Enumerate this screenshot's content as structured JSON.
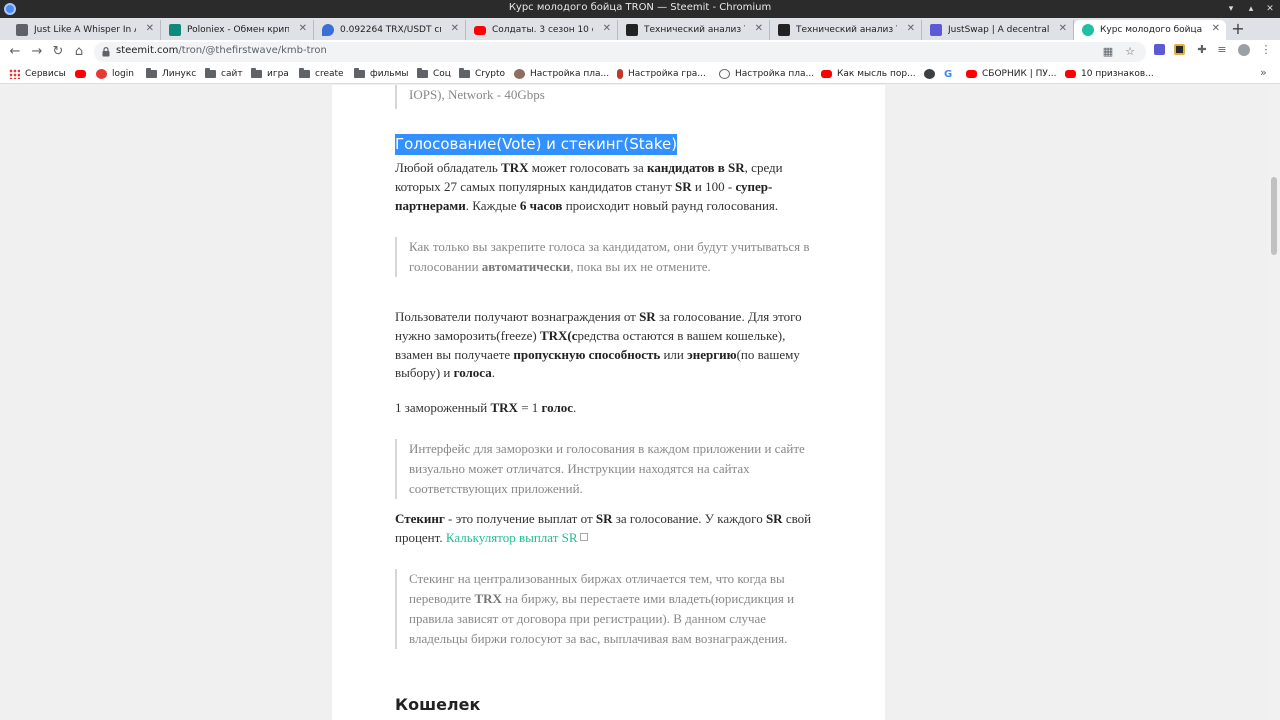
{
  "window": {
    "title": "Курс молодого бойца TRON — Steemit - Chromium"
  },
  "tabs": [
    {
      "label": "Just Like A Whisper In A N",
      "color": "#5f6368"
    },
    {
      "label": "Poloniex - Обмен крипто",
      "color": "#0e8a7a"
    },
    {
      "label": "0.092264 TRX/USDT спот",
      "color": "#3a6fd8"
    },
    {
      "label": "Солдаты. 3 сезон 10 сер",
      "color": "#ff0000"
    },
    {
      "label": "Технический анализ TRO",
      "color": "#222222"
    },
    {
      "label": "Технический анализ TRO",
      "color": "#222222"
    },
    {
      "label": "JustSwap | A decentralize",
      "color": "#5b5bd6"
    },
    {
      "label": "Курс молодого бойца TR",
      "color": "#1fbfa0"
    }
  ],
  "address": {
    "domain": "steemit.com",
    "path": "/tron/@thefirstwave/kmb-tron"
  },
  "bookmarks": [
    {
      "label": "Сервисы",
      "icon": "apps-icon"
    },
    {
      "label": "",
      "icon": "youtube-icon"
    },
    {
      "label": "login",
      "icon": "m-icon"
    },
    {
      "label": "Линукс",
      "icon": "folder-icon"
    },
    {
      "label": "сайт",
      "icon": "folder-icon"
    },
    {
      "label": "игра",
      "icon": "folder-icon"
    },
    {
      "label": "create",
      "icon": "folder-icon"
    },
    {
      "label": "фильмы",
      "icon": "folder-icon"
    },
    {
      "label": "Соц",
      "icon": "folder-icon"
    },
    {
      "label": "Crypto",
      "icon": "folder-icon"
    },
    {
      "label": "Настройка пла...",
      "icon": "person-icon"
    },
    {
      "label": "Настройка гра...",
      "icon": "figure-icon"
    },
    {
      "label": "Настройка пла...",
      "icon": "gear-icon"
    },
    {
      "label": "Как мысль пор...",
      "icon": "youtube-icon"
    },
    {
      "label": "",
      "icon": "globe-icon"
    },
    {
      "label": "",
      "icon": "google-icon"
    },
    {
      "label": "СБОРНИК | ПУ...",
      "icon": "youtube-icon"
    },
    {
      "label": "10 признаков...",
      "icon": "youtube-icon"
    }
  ],
  "article": {
    "top_fragment": "IOPS), Network - 40Gbps",
    "section_heading": "Голосование(Vote) и стекинг(Stake)",
    "p1": {
      "t1": "Любой обладатель ",
      "b1": "TRX",
      "t2": " может голосовать за ",
      "b2": "кандидатов в SR",
      "t3": ", среди которых 27 самых популярных кандидатов станут ",
      "b3": "SR",
      "t4": " и 100 - ",
      "b4": "супер-партнерами",
      "t5": ". Каждые ",
      "b5": "6 часов",
      "t6": " происходит новый раунд голосования."
    },
    "q1": {
      "t1": "Как только вы закрепите голоса за кандидатом, они будут учитываться в голосовании ",
      "b1": "автоматически",
      "t2": ", пока вы их не отмените."
    },
    "p2": {
      "t1": "Пользователи получают вознаграждения от ",
      "b1": "SR",
      "t2": " за голосование. Для этого нужно заморозить(freeze) ",
      "b2": "TRX(с",
      "t3": "редства остаются в вашем кошельке), взамен вы получаете ",
      "b3": "пропускную способность",
      "t4": " или ",
      "b4": "энергию",
      "t5": "(по вашему выбору) и ",
      "b5": "голоса",
      "t6": "."
    },
    "p3": {
      "t1": "1 замороженный ",
      "b1": "TRX",
      "t2": " = 1 ",
      "b2": "голос",
      "t3": "."
    },
    "q2": {
      "text": "Интерфейс для заморозки и голосования в каждом приложении и сайте визуально может отличатся. Инструкции находятся на сайтах соответствующих приложений."
    },
    "p4": {
      "b1": "Стекинг",
      "t1": " - это получение выплат от ",
      "b2": "SR",
      "t2": " за голосование. У каждого ",
      "b3": "SR",
      "t3": " свой процент. ",
      "link": "Калькулятор выплат SR"
    },
    "q3": {
      "t1": "Стекинг на централизованных биржах отличается тем, что когда вы переводите ",
      "b1": "TRX",
      "t2": " на биржу, вы перестаете ими владеть(юрисдикция и правила зависят от договора при регистрации). В данном случае владельцы биржи голосуют за вас, выплачивая вам вознаграждения."
    },
    "heading2": "Кошелек"
  }
}
